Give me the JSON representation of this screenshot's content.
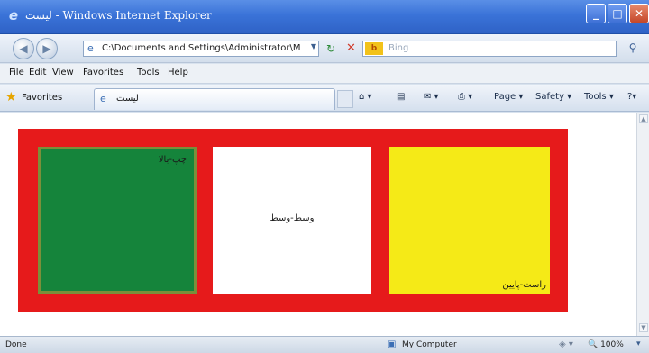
{
  "window": {
    "title": "Windows Internet Explorer",
    "title_rtl": "لیست",
    "icon": "ie-logo-icon"
  },
  "address_bar": {
    "url": "C:\\Documents and Settings\\Administrator\\Ma",
    "search_placeholder": "Bing",
    "search_logo": "Bing"
  },
  "menu": {
    "items": [
      "File",
      "Edit",
      "View",
      "Favorites",
      "Tools",
      "Help"
    ]
  },
  "favorites_bar": {
    "favorites_label": "Favorites",
    "tab_label": "لیست"
  },
  "command_bar": {
    "page": "Page",
    "safety": "Safety",
    "tools": "Tools"
  },
  "content": {
    "frame_color": "#e61a1b",
    "cells": [
      {
        "text": "چپ-بالا",
        "color": "#15843b",
        "align": "top-right"
      },
      {
        "text": "وسط-وسط",
        "color": "#ffffff",
        "align": "middle-center"
      },
      {
        "text": "راست-پایین",
        "color": "#f5ea17",
        "align": "bottom-right"
      }
    ]
  },
  "status_bar": {
    "left": "Done",
    "zone": "My Computer",
    "zoom": "100%"
  }
}
